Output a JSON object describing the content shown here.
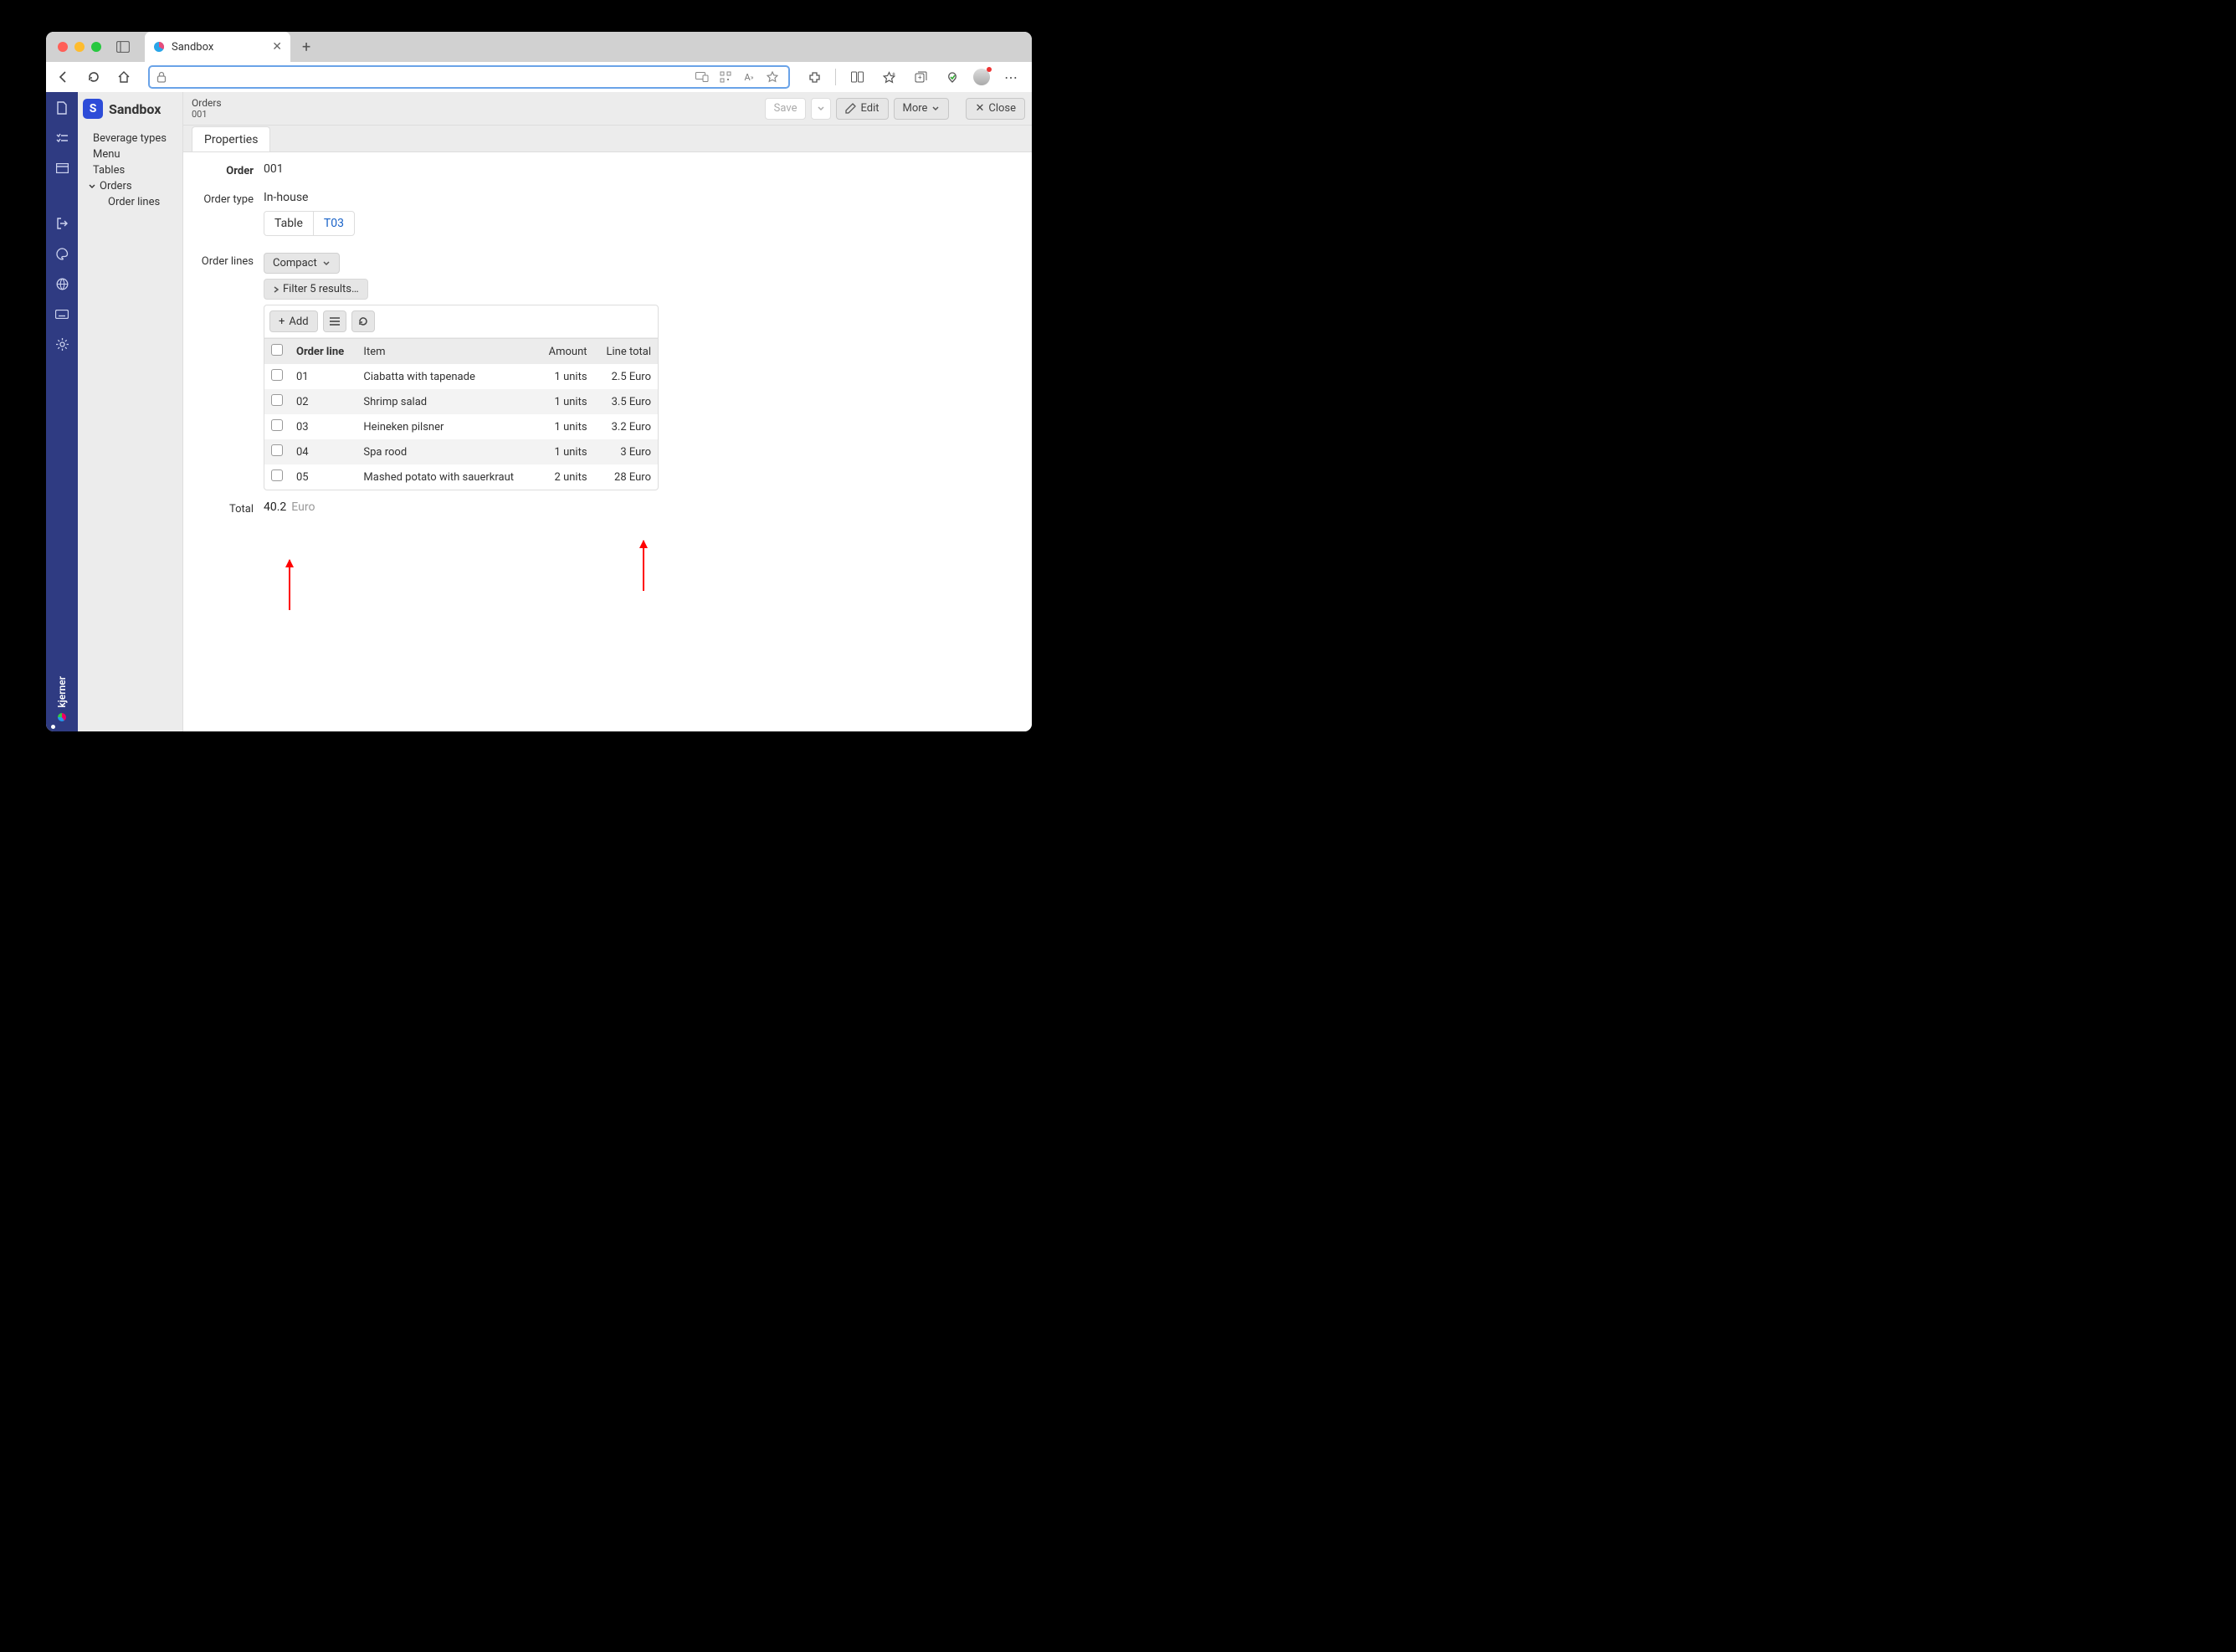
{
  "browser": {
    "tab_title": "Sandbox",
    "right_icons": [
      "responsive",
      "qr",
      "text-size",
      "star",
      "extensions",
      "sidebar",
      "favorites",
      "collections",
      "shopping"
    ]
  },
  "app": {
    "brand": "Sandbox",
    "brand_letter": "S",
    "footer_brand": "kjerner"
  },
  "nav": {
    "items": [
      "Beverage types",
      "Menu",
      "Tables",
      "Orders"
    ],
    "sub": "Order lines"
  },
  "breadcrumb": {
    "title": "Orders",
    "sub": "001"
  },
  "actions": {
    "save": "Save",
    "edit": "Edit",
    "more": "More",
    "close": "Close"
  },
  "tab": "Properties",
  "fields": {
    "order_label": "Order",
    "order_value": "001",
    "order_type_label": "Order type",
    "order_type_value": "In-house",
    "table_label": "Table",
    "table_value": "T03",
    "order_lines_label": "Order lines",
    "view_mode": "Compact",
    "filter_text": "Filter 5 results…",
    "add_label": "Add",
    "total_label": "Total",
    "total_value": "40.2",
    "total_currency": "Euro"
  },
  "table": {
    "columns": [
      "Order line",
      "Item",
      "Amount",
      "Line total"
    ],
    "rows": [
      {
        "id": "01",
        "item": "Ciabatta with tapenade",
        "amount": "1 units",
        "total": "2.5 Euro"
      },
      {
        "id": "02",
        "item": "Shrimp salad",
        "amount": "1 units",
        "total": "3.5 Euro"
      },
      {
        "id": "03",
        "item": "Heineken pilsner",
        "amount": "1 units",
        "total": "3.2 Euro"
      },
      {
        "id": "04",
        "item": "Spa rood",
        "amount": "1 units",
        "total": "3 Euro"
      },
      {
        "id": "05",
        "item": "Mashed potato with sauerkraut",
        "amount": "2 units",
        "total": "28 Euro"
      }
    ]
  }
}
